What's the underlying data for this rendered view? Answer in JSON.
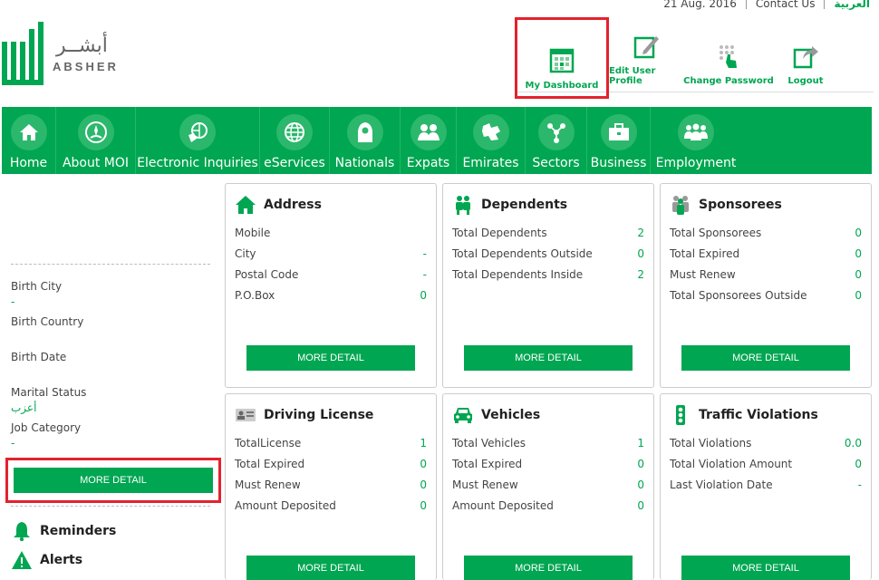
{
  "topbar": {
    "date": "21 Aug. 2016",
    "contact": "Contact Us",
    "language": "العربية"
  },
  "logo": {
    "arabic": "أبشــر",
    "latin": "ABSHER"
  },
  "user_actions": [
    {
      "label": "My Dashboard",
      "icon": "calendar-grid-icon"
    },
    {
      "label": "Edit User Profile",
      "icon": "edit-pencil-icon"
    },
    {
      "label": "Change Password",
      "icon": "keypad-hand-icon"
    },
    {
      "label": "Logout",
      "icon": "logout-arrow-icon"
    }
  ],
  "nav": [
    {
      "label": "Home",
      "icon": "home-icon"
    },
    {
      "label": "About MOI",
      "icon": "emblem-icon"
    },
    {
      "label": "Electronic Inquiries",
      "icon": "globe-hand-icon"
    },
    {
      "label": "eServices",
      "icon": "globe-icon"
    },
    {
      "label": "Nationals",
      "icon": "person-icon"
    },
    {
      "label": "Expats",
      "icon": "group-icon"
    },
    {
      "label": "Emirates",
      "icon": "map-icon"
    },
    {
      "label": "Sectors",
      "icon": "network-icon"
    },
    {
      "label": "Business",
      "icon": "briefcase-icon"
    },
    {
      "label": "Employment",
      "icon": "people-icon"
    }
  ],
  "sidebar": {
    "fields": [
      {
        "label": "Birth City",
        "value": "-"
      },
      {
        "label": "Birth Country",
        "value": ""
      },
      {
        "label": "Birth Date",
        "value": ""
      },
      {
        "label": "Marital Status",
        "value": "أعزب"
      },
      {
        "label": "Job Category",
        "value": "-"
      }
    ],
    "more_detail": "MORE DETAIL",
    "reminders": "Reminders",
    "alerts": "Alerts"
  },
  "cards": {
    "address": {
      "title": "Address",
      "rows": [
        {
          "label": "Mobile",
          "value": ""
        },
        {
          "label": "City",
          "value": "-"
        },
        {
          "label": "Postal Code",
          "value": "-"
        },
        {
          "label": "P.O.Box",
          "value": "0"
        }
      ],
      "button": "MORE DETAIL"
    },
    "dependents": {
      "title": "Dependents",
      "rows": [
        {
          "label": "Total Dependents",
          "value": "2"
        },
        {
          "label": "Total Dependents Outside",
          "value": "0"
        },
        {
          "label": "Total Dependents Inside",
          "value": "2"
        }
      ],
      "button": "MORE DETAIL"
    },
    "sponsorees": {
      "title": "Sponsorees",
      "rows": [
        {
          "label": "Total Sponsorees",
          "value": "0"
        },
        {
          "label": "Total Expired",
          "value": "0"
        },
        {
          "label": "Must Renew",
          "value": "0"
        },
        {
          "label": "Total Sponsorees Outside",
          "value": "0"
        }
      ],
      "button": "MORE DETAIL"
    },
    "driving": {
      "title": "Driving License",
      "rows": [
        {
          "label": "TotalLicense",
          "value": "1"
        },
        {
          "label": "Total Expired",
          "value": "0"
        },
        {
          "label": "Must Renew",
          "value": "0"
        },
        {
          "label": "Amount Deposited",
          "value": "0"
        }
      ],
      "button": "MORE DETAIL"
    },
    "vehicles": {
      "title": "Vehicles",
      "rows": [
        {
          "label": "Total Vehicles",
          "value": "1"
        },
        {
          "label": "Total Expired",
          "value": "0"
        },
        {
          "label": "Must Renew",
          "value": "0"
        },
        {
          "label": "Amount Deposited",
          "value": "0"
        }
      ],
      "button": "MORE DETAIL"
    },
    "traffic": {
      "title": "Traffic Violations",
      "rows": [
        {
          "label": "Total Violations",
          "value": "0.0"
        },
        {
          "label": "Total Violation Amount",
          "value": "0"
        },
        {
          "label": "Last Violation Date",
          "value": "-"
        }
      ],
      "button": "MORE DETAIL"
    }
  },
  "colors": {
    "brand_green": "#00a651",
    "highlight_red": "#e4222e"
  }
}
